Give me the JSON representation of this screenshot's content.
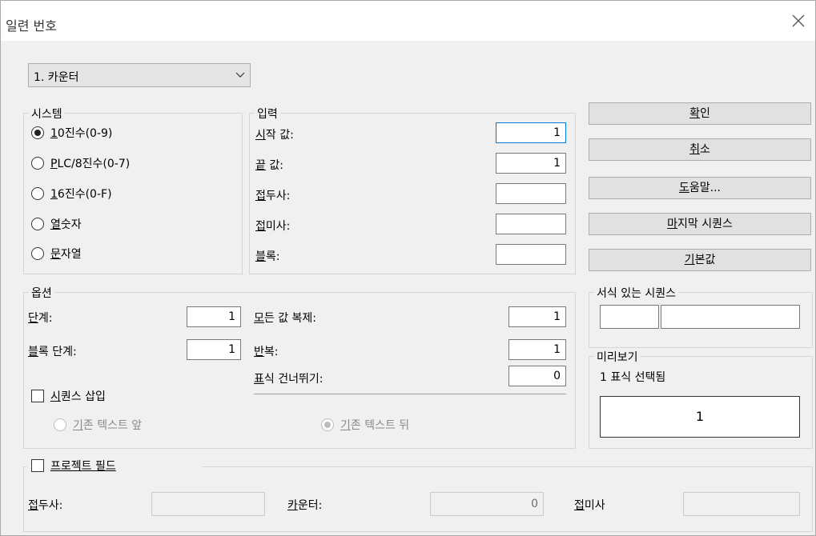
{
  "window": {
    "title": "일련 번호"
  },
  "combo": {
    "value": "1. 카운터"
  },
  "system": {
    "title": "시스템",
    "options": [
      {
        "ul": "1",
        "rest": "0진수(0-9)",
        "selected": true
      },
      {
        "ul": "P",
        "rest": "LC/8진수(0-7)",
        "selected": false
      },
      {
        "ul": "1",
        "rest": "6진수(0-F)",
        "selected": false
      },
      {
        "ul": "열",
        "rest": "숫자",
        "selected": false
      },
      {
        "ul": "문",
        "rest": "자열",
        "selected": false
      }
    ]
  },
  "input": {
    "title": "입력",
    "start": {
      "ul": "시",
      "rest": "작 값:",
      "value": "1"
    },
    "end": {
      "ul": "끝",
      "rest": " 값:",
      "value": "1"
    },
    "prefix": {
      "ul": "접",
      "rest": "두사:",
      "value": ""
    },
    "suffix": {
      "ul": "접",
      "rest": "미사:",
      "value": ""
    },
    "block": {
      "ul": "블",
      "rest": "록:",
      "value": ""
    }
  },
  "buttons": {
    "ok": {
      "ul": "확",
      "rest": "인"
    },
    "cancel": {
      "ul": "취",
      "rest": "소"
    },
    "help": {
      "ul": "도",
      "rest": "움말..."
    },
    "last": {
      "ul": "마",
      "rest": "지막 시퀀스"
    },
    "default": {
      "ul": "기",
      "rest": "본값"
    }
  },
  "options": {
    "title": "옵션",
    "step": {
      "ul": "단",
      "rest": "계:",
      "value": "1"
    },
    "block_step": {
      "ul": "블",
      "rest": "록 단계:",
      "value": "1"
    },
    "dup": {
      "ul": "모",
      "rest": "든 값 복제:",
      "value": "1"
    },
    "repeat": {
      "ul": "반",
      "rest": "복:",
      "value": "1"
    },
    "skip": {
      "ul": "표",
      "rest": "식 건너뛰기:",
      "value": "0"
    },
    "insert": {
      "ul": "시",
      "rest": "퀀스 삽입",
      "checked": false
    },
    "before": {
      "ul": "기",
      "rest": "존 텍스트 앞"
    },
    "after": {
      "ul": "기",
      "rest": "존 텍스트 뒤"
    }
  },
  "formatted": {
    "title": "서식 있는 시퀀스"
  },
  "preview": {
    "title": "미리보기",
    "subtitle": "1 표식 선택됨",
    "value": "1"
  },
  "project": {
    "title": "프로젝트 필드",
    "prefix": {
      "ul": "접",
      "rest": "두사:",
      "value": ""
    },
    "counter": {
      "ul": "카",
      "rest": "운터:",
      "value": "0"
    },
    "suffix": {
      "ul": "접",
      "rest": "미사",
      "value": ""
    }
  }
}
